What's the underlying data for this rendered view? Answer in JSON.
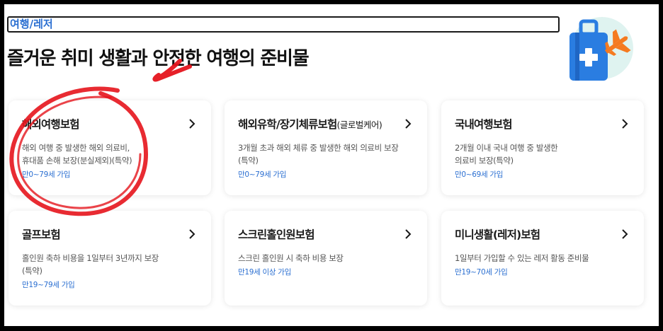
{
  "category": {
    "label": "여행/레저"
  },
  "headline": "즐거운 취미 생활과 안전한 여행의 준비물",
  "colors": {
    "accent": "#2b6fd1",
    "brush": "#e5141c",
    "suitcase": "#2a7de1",
    "plane": "#f57a20",
    "bubble": "#dff3f0"
  },
  "icons": {
    "chevron": "chevron-right-icon",
    "illustration": "travel-suitcase-plane-icon"
  },
  "cards": [
    {
      "title": "해외여행보험",
      "subtitle": "",
      "desc_lines": [
        "해외 여행 중 발생한 해외 의료비,",
        "휴대품 손해 보장(분실제외)(특약)"
      ],
      "age": "만0~79세 가입"
    },
    {
      "title": "해외유학/장기체류보험",
      "subtitle": "(글로벌케어)",
      "desc_lines": [
        "3개월 초과 해외 체류 중 발생한 해외 의료비 보장",
        "(특약)"
      ],
      "age": "만0~79세 가입"
    },
    {
      "title": "국내여행보험",
      "subtitle": "",
      "desc_lines": [
        "2개월 이내 국내 여행 중 발생한",
        "의료비 보장(특약)"
      ],
      "age": "만0~69세 가입"
    },
    {
      "title": "골프보험",
      "subtitle": "",
      "desc_lines": [
        "홀인원 축하 비용을 1일부터 3년까지 보장",
        "(특약)"
      ],
      "age": "만19~79세 가입"
    },
    {
      "title": "스크린홀인원보험",
      "subtitle": "",
      "desc_lines": [
        "스크린 홀인원 시 축하 비용 보장"
      ],
      "age": "만19세 이상 가입"
    },
    {
      "title": "미니생활(레저)보험",
      "subtitle": "",
      "desc_lines": [
        "1일부터 가입할 수 있는 레저 활동 준비물"
      ],
      "age": "만19~70세 가입"
    }
  ]
}
